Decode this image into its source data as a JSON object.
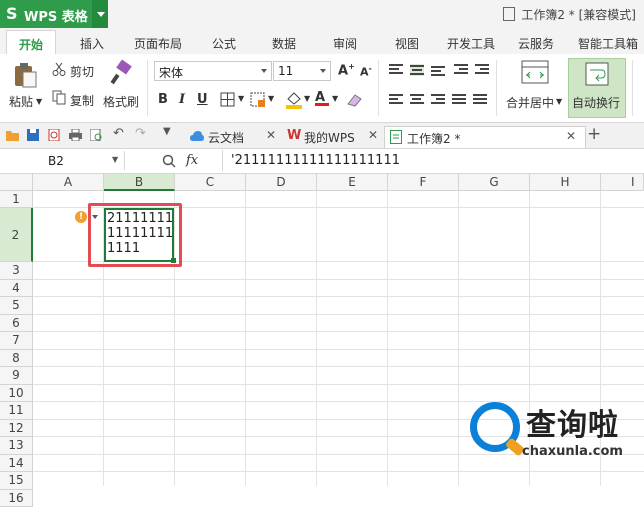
{
  "app": {
    "name": "WPS 表格",
    "logo": "S"
  },
  "window_title": "工作簿2 * [兼容模式]",
  "ribbon_tabs": [
    "开始",
    "插入",
    "页面布局",
    "公式",
    "数据",
    "审阅",
    "视图",
    "开发工具",
    "云服务",
    "智能工具箱"
  ],
  "ribbon": {
    "cut": "剪切",
    "paste": "粘贴",
    "copy": "复制",
    "format_painter": "格式刷",
    "font_name": "宋体",
    "font_size": "11",
    "merge_center": "合并居中",
    "wrap_text": "自动换行"
  },
  "doc_tabs": [
    "云文档",
    "我的WPS",
    "工作簿2 *"
  ],
  "name_box": "B2",
  "fx_label": "fx",
  "formula_value": "'21111111111111111111",
  "columns": [
    "A",
    "B",
    "C",
    "D",
    "E",
    "F",
    "G",
    "H",
    "I"
  ],
  "rows": [
    "1",
    "2",
    "3",
    "4",
    "5",
    "6",
    "7",
    "8",
    "9",
    "10",
    "11",
    "12",
    "13",
    "14",
    "15",
    "16"
  ],
  "cell_b2_value": "21111111\n11111111\n1111",
  "warning_icon": "!",
  "watermark": {
    "brand": "查询啦",
    "url": "chaxunla.com"
  },
  "colors": {
    "brand_green": "#2e9c4a",
    "highlight_red": "#e14d53",
    "selection_green": "#217a3a"
  }
}
